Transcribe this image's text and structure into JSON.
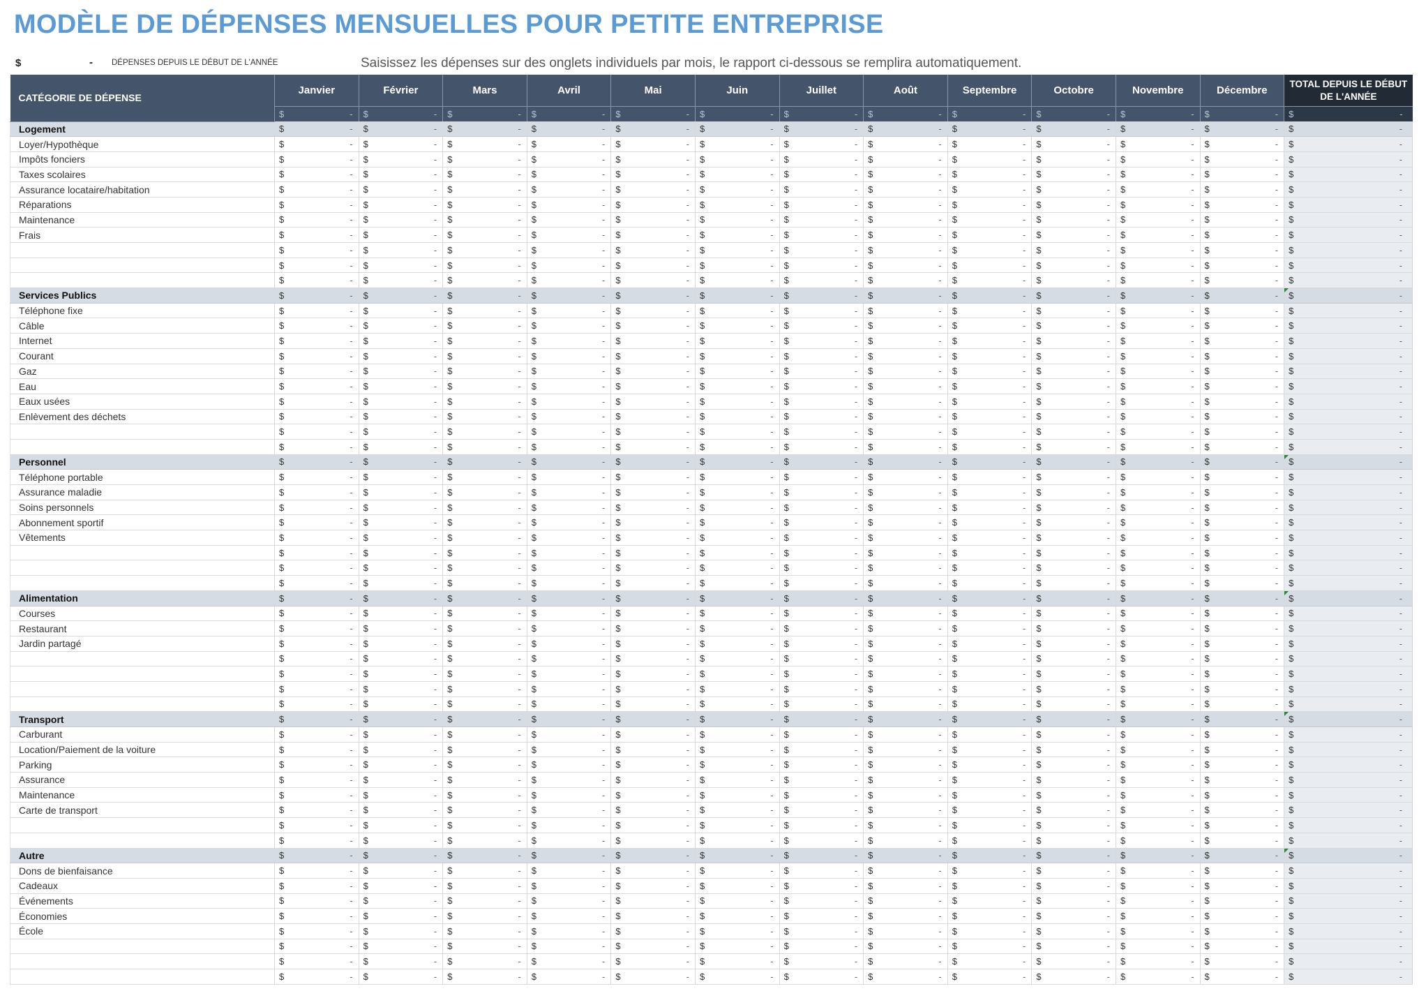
{
  "title": "MODÈLE DE DÉPENSES MENSUELLES POUR PETITE ENTREPRISE",
  "summary": {
    "currency": "$",
    "value": "-",
    "label": "DÉPENSES DEPUIS LE DÉBUT DE L'ANNÉE"
  },
  "instruction": "Saisissez les dépenses sur des onglets individuels par mois, le rapport ci-dessous se remplira automatiquement.",
  "table": {
    "category_header": "CATÉGORIE DE DÉPENSE",
    "months": [
      "Janvier",
      "Février",
      "Mars",
      "Avril",
      "Mai",
      "Juin",
      "Juillet",
      "Août",
      "Septembre",
      "Octobre",
      "Novembre",
      "Décembre"
    ],
    "total_header": "TOTAL DEPUIS LE DÉBUT DE L'ANNÉE",
    "currency_symbol": "$",
    "empty_value": "-",
    "sections": [
      {
        "name": "Logement",
        "flagged_total": false,
        "items": [
          "Loyer/Hypothèque",
          "Impôts fonciers",
          "Taxes scolaires",
          "Assurance locataire/habitation",
          "Réparations",
          "Maintenance",
          "Frais",
          "",
          "",
          ""
        ]
      },
      {
        "name": "Services Publics",
        "flagged_total": true,
        "items": [
          "Téléphone fixe",
          "Câble",
          "Internet",
          "Courant",
          "Gaz",
          "Eau",
          "Eaux usées",
          "Enlèvement des déchets",
          "",
          ""
        ]
      },
      {
        "name": "Personnel",
        "flagged_total": true,
        "items": [
          "Téléphone portable",
          "Assurance maladie",
          "Soins personnels",
          "Abonnement sportif",
          "Vêtements",
          "",
          "",
          ""
        ]
      },
      {
        "name": "Alimentation",
        "flagged_total": true,
        "items": [
          "Courses",
          "Restaurant",
          "Jardin partagé",
          "",
          "",
          "",
          ""
        ]
      },
      {
        "name": "Transport",
        "flagged_total": true,
        "items": [
          "Carburant",
          "Location/Paiement de la voiture",
          "Parking",
          "Assurance",
          "Maintenance",
          "Carte de transport",
          "",
          ""
        ]
      },
      {
        "name": "Autre",
        "flagged_total": true,
        "items": [
          "Dons de bienfaisance",
          "Cadeaux",
          "Événements",
          "Économies",
          "École",
          "",
          "",
          ""
        ]
      }
    ]
  },
  "colors": {
    "title": "#5b9bd5",
    "header_bg": "#44546a",
    "total_header_bg": "#222b35",
    "section_bg": "#d6dce4",
    "total_col_bg": "#e9ecf0",
    "flag": "#1e8a3c"
  }
}
